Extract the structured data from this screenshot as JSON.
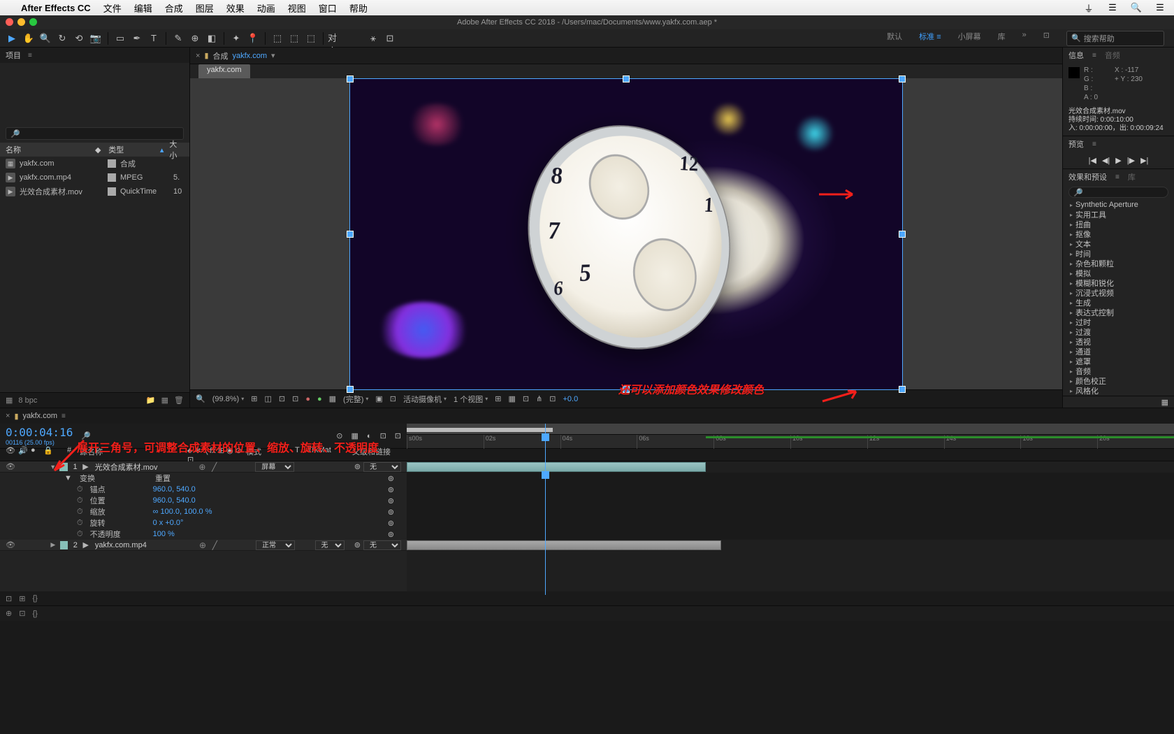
{
  "menubar": {
    "app": "After Effects CC",
    "items": [
      "文件",
      "编辑",
      "合成",
      "图层",
      "效果",
      "动画",
      "视图",
      "窗口",
      "帮助"
    ]
  },
  "titlebar": {
    "title": "Adobe After Effects CC 2018 - /Users/mac/Documents/www.yakfx.com.aep *"
  },
  "workspaces": {
    "items": [
      "默认",
      "标准",
      "小屏幕",
      "库"
    ],
    "active": 1,
    "search_placeholder": "搜索帮助"
  },
  "project": {
    "tab": "项目",
    "search_placeholder": "",
    "columns": {
      "name": "名称",
      "type": "类型",
      "size": "大小"
    },
    "items": [
      {
        "name": "yakfx.com",
        "type": "合成",
        "size": ""
      },
      {
        "name": "yakfx.com.mp4",
        "type": "MPEG",
        "size": "5."
      },
      {
        "name": "光效合成素材.mov",
        "type": "QuickTime",
        "size": "10"
      }
    ],
    "footer_bpc": "8 bpc"
  },
  "comp": {
    "breadcrumb_folder": "合成",
    "breadcrumb_name": "yakfx.com",
    "nested_tab": "yakfx.com",
    "footer": {
      "zoom": "(99.8%)",
      "res": "(完整)",
      "camera": "活动摄像机",
      "views": "1 个视图",
      "exposure": "+0.0"
    }
  },
  "info": {
    "tabs": {
      "info": "信息",
      "audio": "音频"
    },
    "rgba": {
      "r": "R :",
      "g": "G :",
      "b": "B :",
      "a": "A : 0"
    },
    "xy": {
      "x": "X : -117",
      "y": "Y : 230",
      "plus": "+"
    },
    "clip": {
      "name": "光效合成素材.mov",
      "dur": "持续时间: 0:00:10:00",
      "inout": "入: 0:00:00:00，出: 0:00:09:24"
    }
  },
  "preview": {
    "tab": "预览"
  },
  "effects": {
    "tabs": {
      "effects": "效果和预设",
      "lib": "库"
    },
    "list": [
      "Synthetic Aperture",
      "实用工具",
      "扭曲",
      "抠像",
      "文本",
      "时间",
      "杂色和颗粒",
      "模拟",
      "模糊和锐化",
      "沉浸式视频",
      "生成",
      "表达式控制",
      "过时",
      "过渡",
      "透视",
      "通道",
      "遮罩",
      "音频",
      "颜色校正",
      "风格化"
    ]
  },
  "timeline": {
    "tab": "yakfx.com",
    "timecode": "0:00:04:16",
    "frames": "00116 (25.00 fps)",
    "ruler_marks": [
      "s00s",
      "02s",
      "04s",
      "06s",
      "08s",
      "10s",
      "12s",
      "14s",
      "16s",
      "20s"
    ],
    "columns": {
      "source": "源名称",
      "mode": "模式",
      "trkmat": "TrkMat",
      "parent": "父级和链接"
    },
    "layers": [
      {
        "num": "1",
        "name": "光效合成素材.mov",
        "mode": "屏幕",
        "parent": "无"
      },
      {
        "num": "2",
        "name": "yakfx.com.mp4",
        "mode": "正常",
        "parent": "无",
        "trkmat": "无"
      }
    ],
    "transform": {
      "label": "变换",
      "reset": "重置",
      "anchor": {
        "label": "锚点",
        "value": "960.0, 540.0"
      },
      "position": {
        "label": "位置",
        "value": "960.0, 540.0"
      },
      "scale": {
        "label": "缩放",
        "value": "100.0, 100.0 %",
        "link": "∞"
      },
      "rotation": {
        "label": "旋转",
        "value": "0 x +0.0°"
      },
      "opacity": {
        "label": "不透明度",
        "value": "100 %"
      }
    },
    "trkmat_none": "无"
  },
  "annotations": {
    "a1": "展开三角号，可调整合成素材的位置、缩放、旋转、不透明度",
    "a2": "还可以添加颜色效果修改颜色"
  }
}
